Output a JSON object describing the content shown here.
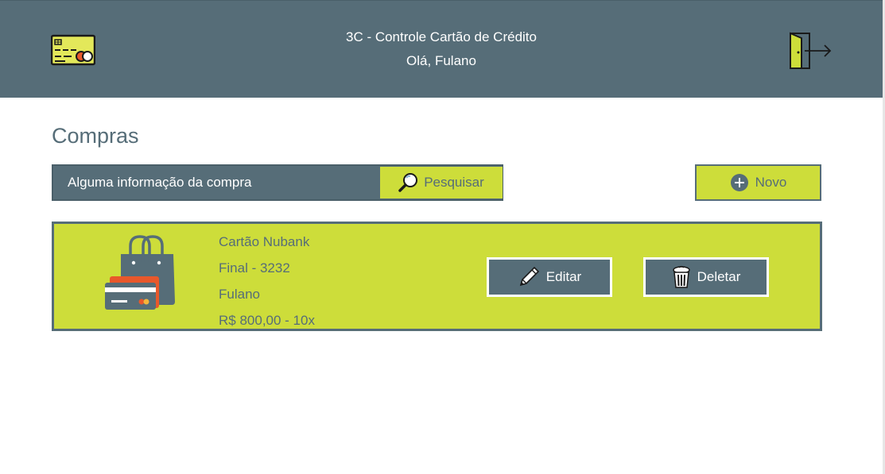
{
  "header": {
    "app_title": "3C - Controle Cartão de Crédito",
    "greeting": "Olá, Fulano"
  },
  "page": {
    "title": "Compras"
  },
  "search": {
    "placeholder": "Alguma informação da compra",
    "button_label": "Pesquisar"
  },
  "actions": {
    "new_label": "Novo"
  },
  "purchase": {
    "card_name": "Cartão Nubank",
    "card_final": "Final - 3232",
    "holder": "Fulano",
    "amount": "R$ 800,00 - 10x",
    "edit_label": "Editar",
    "delete_label": "Deletar"
  },
  "colors": {
    "primary": "#566d78",
    "accent": "#cddd3a",
    "background": "#ffffff",
    "text_on_primary": "#ffffff",
    "orange": "#e8582b"
  },
  "icons": {
    "logo": "credit-card-icon",
    "logout": "exit-door-icon",
    "search": "magnifier-icon",
    "new": "plus-circle-icon",
    "edit": "pencil-icon",
    "delete": "trash-icon",
    "purchase": "shopping-bag-card-icon"
  }
}
